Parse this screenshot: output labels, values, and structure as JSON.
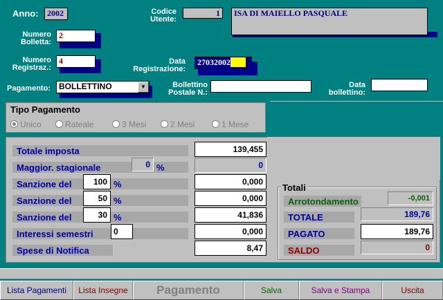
{
  "header": {
    "anno_label": "Anno:",
    "anno_value": "2002",
    "codice_label_1": "Codice",
    "codice_label_2": "Utente:",
    "codice_value": "1",
    "utente_name": "ISA DI MAIELLO PASQUALE",
    "numero_bolletta_label_1": "Numero",
    "numero_bolletta_label_2": "Bolletta:",
    "numero_bolletta_value": "2",
    "numero_registraz_label_1": "Numero",
    "numero_registraz_label_2": "Registraz.:",
    "numero_registraz_value": "4",
    "data_registrazione_label_1": "Data",
    "data_registrazione_label_2": "Registrazione:",
    "data_registrazione_value": "27032002",
    "pagamento_label": "Pagamento:",
    "pagamento_value": "BOLLETTINO",
    "bollettino_label_1": "Bollettino",
    "bollettino_label_2": "Postale N.:",
    "bollettino_value": "",
    "data_bollettino_label_1": "Data",
    "data_bollettino_label_2": "bollettino:",
    "data_bollettino_value": ""
  },
  "tipo_pagamento": {
    "title": "Tipo Pagamento",
    "options": [
      "Unico",
      "Rateale",
      "3 Mesi",
      "2 Mesi",
      "1 Mese"
    ],
    "selected": "Unico"
  },
  "imposte": {
    "totale_imposta_label": "Totale imposta",
    "totale_imposta_value": "139,455",
    "maggior_label": "Maggior. stagionale",
    "maggior_pct": "0",
    "maggior_value": "0",
    "sanzione1_label": "Sanzione del",
    "sanzione1_pct": "100",
    "sanzione1_value": "0,000",
    "sanzione2_label": "Sanzione del",
    "sanzione2_pct": "50",
    "sanzione2_value": "0,000",
    "sanzione3_label": "Sanzione del",
    "sanzione3_pct": "30",
    "sanzione3_value": "41,836",
    "interessi_label": "Interessi semestri",
    "interessi_count": "0",
    "interessi_value": "0,000",
    "spese_label": "Spese di Notifica",
    "spese_value": "8,47",
    "pct_symbol": "%"
  },
  "totali": {
    "title": "Totali",
    "arrotondamento_label": "Arrotondamento",
    "arrotondamento_value": "-0,001",
    "totale_label": "TOTALE",
    "totale_value": "189,76",
    "pagato_label": "PAGATO",
    "pagato_value": "189,76",
    "saldo_label": "SALDO",
    "saldo_value": "0"
  },
  "footer": {
    "lista_pagamenti": "Lista Pagamenti",
    "lista_insegne": "Lista Insegne",
    "pagamento": "Pagamento",
    "salva": "Salva",
    "salva_stampa": "Salva e Stampa",
    "uscita": "Uscita"
  },
  "colors": {
    "background": "#008080",
    "field_shadow": "#00008b",
    "label_blue": "#0000a0",
    "highlight_yellow": "#ffff00",
    "green": "#006400",
    "dark_red": "#8b0000"
  }
}
